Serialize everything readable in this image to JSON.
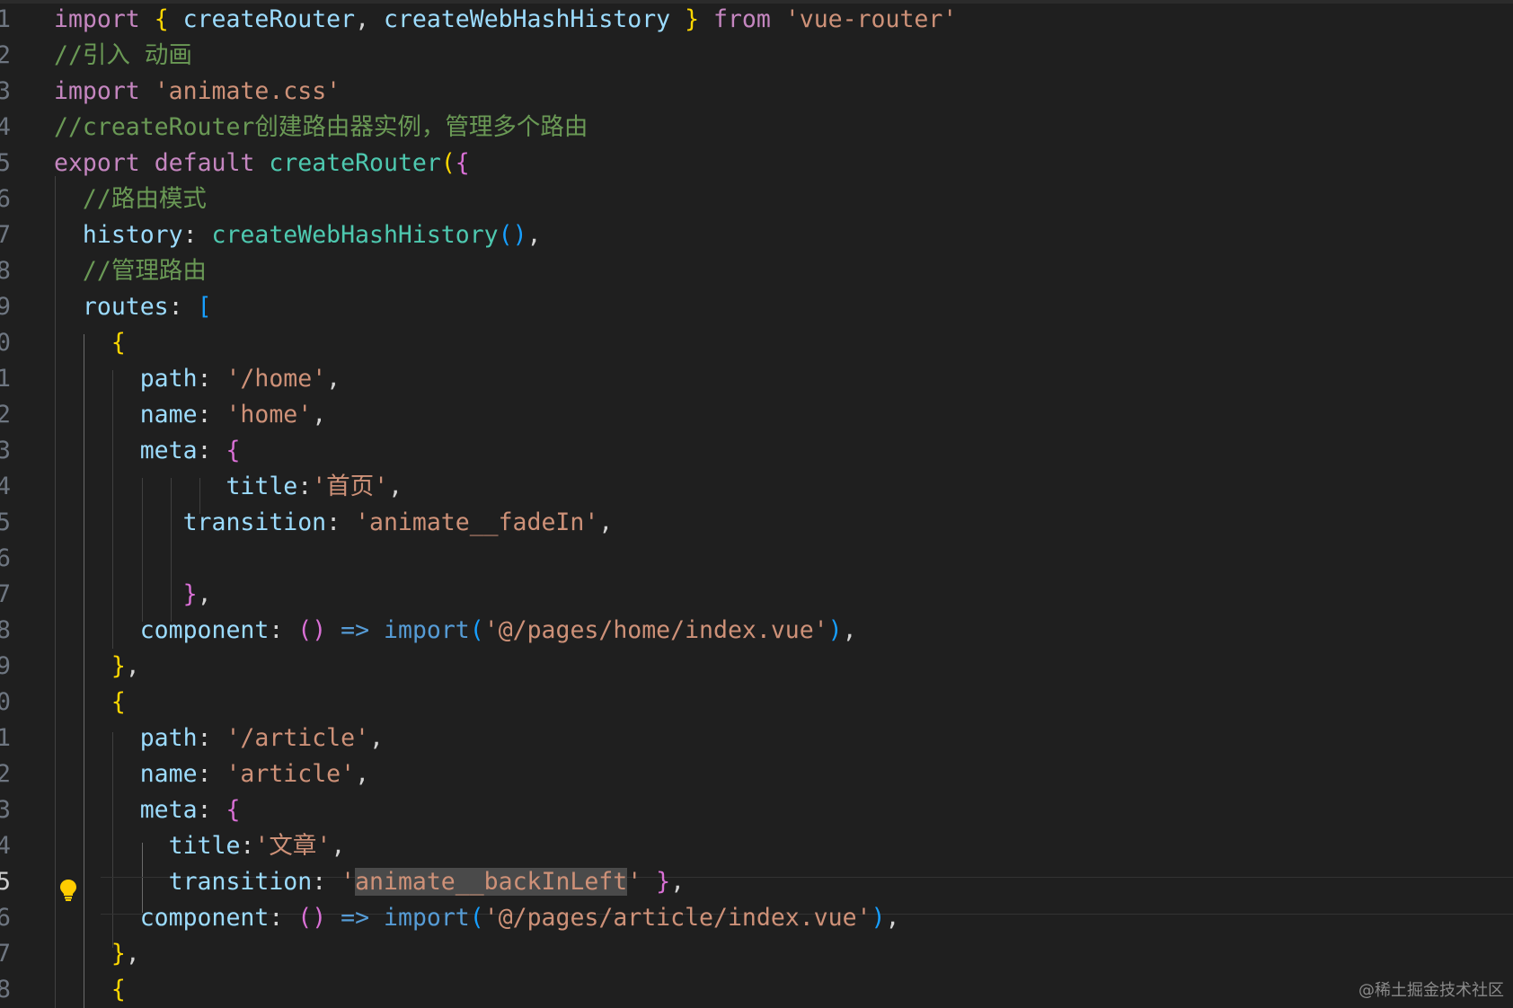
{
  "editor": {
    "current_line": "5",
    "watermark": "@稀土掘金技术社区",
    "lines": [
      {
        "num": "1",
        "tokens": [
          {
            "t": "import",
            "c": "kw"
          },
          {
            "t": " ",
            "c": "punc"
          },
          {
            "t": "{",
            "c": "b1"
          },
          {
            "t": " ",
            "c": "punc"
          },
          {
            "t": "createRouter",
            "c": "prop"
          },
          {
            "t": ", ",
            "c": "punc"
          },
          {
            "t": "createWebHashHistory",
            "c": "prop"
          },
          {
            "t": " ",
            "c": "punc"
          },
          {
            "t": "}",
            "c": "b1"
          },
          {
            "t": " ",
            "c": "punc"
          },
          {
            "t": "from",
            "c": "kw"
          },
          {
            "t": " ",
            "c": "punc"
          },
          {
            "t": "'vue-router'",
            "c": "str"
          }
        ]
      },
      {
        "num": "2",
        "tokens": [
          {
            "t": "//引入 动画",
            "c": "cmt"
          }
        ]
      },
      {
        "num": "3",
        "tokens": [
          {
            "t": "import",
            "c": "kw"
          },
          {
            "t": " ",
            "c": "punc"
          },
          {
            "t": "'animate.css'",
            "c": "str"
          }
        ]
      },
      {
        "num": "4",
        "tokens": [
          {
            "t": "//createRouter创建路由器实例，管理多个路由",
            "c": "cmt"
          }
        ]
      },
      {
        "num": "5",
        "tokens": [
          {
            "t": "export",
            "c": "kw"
          },
          {
            "t": " ",
            "c": "punc"
          },
          {
            "t": "default",
            "c": "kw"
          },
          {
            "t": " ",
            "c": "punc"
          },
          {
            "t": "createRouter",
            "c": "fn"
          },
          {
            "t": "(",
            "c": "b1"
          },
          {
            "t": "{",
            "c": "b2"
          }
        ]
      },
      {
        "num": "6",
        "tokens": [
          {
            "t": "  //路由模式",
            "c": "cmt"
          }
        ]
      },
      {
        "num": "7",
        "tokens": [
          {
            "t": "  history",
            "c": "prop"
          },
          {
            "t": ": ",
            "c": "punc"
          },
          {
            "t": "createWebHashHistory",
            "c": "fn"
          },
          {
            "t": "()",
            "c": "b3"
          },
          {
            "t": ",",
            "c": "punc"
          }
        ]
      },
      {
        "num": "8",
        "tokens": [
          {
            "t": "  //管理路由",
            "c": "cmt"
          }
        ]
      },
      {
        "num": "9",
        "tokens": [
          {
            "t": "  routes",
            "c": "prop"
          },
          {
            "t": ": ",
            "c": "punc"
          },
          {
            "t": "[",
            "c": "b3"
          }
        ]
      },
      {
        "num": "0",
        "tokens": [
          {
            "t": "    ",
            "c": "punc"
          },
          {
            "t": "{",
            "c": "b1"
          }
        ]
      },
      {
        "num": "1",
        "tokens": [
          {
            "t": "      path",
            "c": "prop"
          },
          {
            "t": ": ",
            "c": "punc"
          },
          {
            "t": "'/home'",
            "c": "str"
          },
          {
            "t": ",",
            "c": "punc"
          }
        ]
      },
      {
        "num": "2",
        "tokens": [
          {
            "t": "      name",
            "c": "prop"
          },
          {
            "t": ": ",
            "c": "punc"
          },
          {
            "t": "'home'",
            "c": "str"
          },
          {
            "t": ",",
            "c": "punc"
          }
        ]
      },
      {
        "num": "3",
        "tokens": [
          {
            "t": "      meta",
            "c": "prop"
          },
          {
            "t": ": ",
            "c": "punc"
          },
          {
            "t": "{",
            "c": "b2"
          }
        ]
      },
      {
        "num": "4",
        "tokens": [
          {
            "t": "            title",
            "c": "prop"
          },
          {
            "t": ":",
            "c": "punc"
          },
          {
            "t": "'首页'",
            "c": "str"
          },
          {
            "t": ",",
            "c": "punc"
          }
        ]
      },
      {
        "num": "5",
        "tokens": [
          {
            "t": "         transition",
            "c": "prop"
          },
          {
            "t": ": ",
            "c": "punc"
          },
          {
            "t": "'animate__fadeIn'",
            "c": "str"
          },
          {
            "t": ",",
            "c": "punc"
          }
        ]
      },
      {
        "num": "6",
        "tokens": []
      },
      {
        "num": "7",
        "tokens": [
          {
            "t": "         ",
            "c": "punc"
          },
          {
            "t": "}",
            "c": "b2"
          },
          {
            "t": ",",
            "c": "punc"
          }
        ]
      },
      {
        "num": "8",
        "tokens": [
          {
            "t": "      component",
            "c": "prop"
          },
          {
            "t": ": ",
            "c": "punc"
          },
          {
            "t": "()",
            "c": "b2"
          },
          {
            "t": " ",
            "c": "punc"
          },
          {
            "t": "=>",
            "c": "op"
          },
          {
            "t": " ",
            "c": "punc"
          },
          {
            "t": "import",
            "c": "fnb"
          },
          {
            "t": "(",
            "c": "b3"
          },
          {
            "t": "'@/pages/home/index.vue'",
            "c": "str"
          },
          {
            "t": ")",
            "c": "b3"
          },
          {
            "t": ",",
            "c": "punc"
          }
        ]
      },
      {
        "num": "9",
        "tokens": [
          {
            "t": "    ",
            "c": "punc"
          },
          {
            "t": "}",
            "c": "b1"
          },
          {
            "t": ",",
            "c": "punc"
          }
        ]
      },
      {
        "num": "0",
        "tokens": [
          {
            "t": "    ",
            "c": "punc"
          },
          {
            "t": "{",
            "c": "b1"
          }
        ]
      },
      {
        "num": "1",
        "tokens": [
          {
            "t": "      path",
            "c": "prop"
          },
          {
            "t": ": ",
            "c": "punc"
          },
          {
            "t": "'/article'",
            "c": "str"
          },
          {
            "t": ",",
            "c": "punc"
          }
        ]
      },
      {
        "num": "2",
        "tokens": [
          {
            "t": "      name",
            "c": "prop"
          },
          {
            "t": ": ",
            "c": "punc"
          },
          {
            "t": "'article'",
            "c": "str"
          },
          {
            "t": ",",
            "c": "punc"
          }
        ]
      },
      {
        "num": "3",
        "tokens": [
          {
            "t": "      meta",
            "c": "prop"
          },
          {
            "t": ": ",
            "c": "punc"
          },
          {
            "t": "{",
            "c": "b2"
          }
        ]
      },
      {
        "num": "4",
        "tokens": [
          {
            "t": "        title",
            "c": "prop"
          },
          {
            "t": ":",
            "c": "punc"
          },
          {
            "t": "'文章'",
            "c": "str"
          },
          {
            "t": ",",
            "c": "punc"
          }
        ]
      },
      {
        "num": "5",
        "tokens": [
          {
            "t": "        transition",
            "c": "prop"
          },
          {
            "t": ": ",
            "c": "punc"
          },
          {
            "t": "'",
            "c": "str"
          },
          {
            "t": "animate__backInLeft",
            "c": "str sel"
          },
          {
            "t": "'",
            "c": "str"
          },
          {
            "t": " ",
            "c": "punc"
          },
          {
            "t": "}",
            "c": "b2"
          },
          {
            "t": ",",
            "c": "punc"
          }
        ]
      },
      {
        "num": "6",
        "tokens": [
          {
            "t": "      component",
            "c": "prop"
          },
          {
            "t": ": ",
            "c": "punc"
          },
          {
            "t": "()",
            "c": "b2"
          },
          {
            "t": " ",
            "c": "punc"
          },
          {
            "t": "=>",
            "c": "op"
          },
          {
            "t": " ",
            "c": "punc"
          },
          {
            "t": "import",
            "c": "fnb"
          },
          {
            "t": "(",
            "c": "b3"
          },
          {
            "t": "'@/pages/article/index.vue'",
            "c": "str"
          },
          {
            "t": ")",
            "c": "b3"
          },
          {
            "t": ",",
            "c": "punc"
          }
        ]
      },
      {
        "num": "7",
        "tokens": [
          {
            "t": "    ",
            "c": "punc"
          },
          {
            "t": "}",
            "c": "b1"
          },
          {
            "t": ",",
            "c": "punc"
          }
        ]
      },
      {
        "num": "8",
        "tokens": [
          {
            "t": "    ",
            "c": "punc"
          },
          {
            "t": "{",
            "c": "b1"
          }
        ]
      }
    ]
  }
}
